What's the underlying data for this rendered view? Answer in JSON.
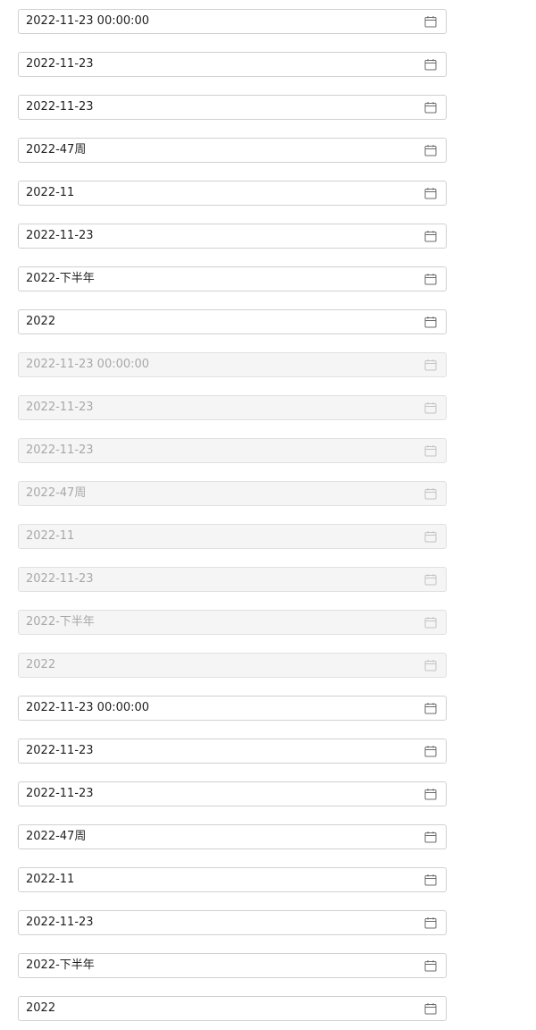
{
  "groups": [
    {
      "state": "normal",
      "pickers": [
        {
          "value": "2022-11-23 00:00:00",
          "icon": "calendar-icon"
        },
        {
          "value": "2022-11-23",
          "icon": "calendar-icon"
        },
        {
          "value": "2022-11-23",
          "icon": "calendar-icon"
        },
        {
          "value": "2022-47周",
          "icon": "calendar-icon"
        },
        {
          "value": "2022-11",
          "icon": "calendar-icon"
        },
        {
          "value": "2022-11-23",
          "icon": "calendar-icon"
        },
        {
          "value": "2022-下半年",
          "icon": "calendar-icon"
        },
        {
          "value": "2022",
          "icon": "calendar-icon"
        }
      ]
    },
    {
      "state": "disabled",
      "pickers": [
        {
          "value": "2022-11-23 00:00:00",
          "icon": "calendar-icon"
        },
        {
          "value": "2022-11-23",
          "icon": "calendar-icon"
        },
        {
          "value": "2022-11-23",
          "icon": "calendar-icon"
        },
        {
          "value": "2022-47周",
          "icon": "calendar-icon"
        },
        {
          "value": "2022-11",
          "icon": "calendar-icon"
        },
        {
          "value": "2022-11-23",
          "icon": "calendar-icon"
        },
        {
          "value": "2022-下半年",
          "icon": "calendar-icon"
        },
        {
          "value": "2022",
          "icon": "calendar-icon"
        }
      ]
    },
    {
      "state": "normal",
      "pickers": [
        {
          "value": "2022-11-23 00:00:00",
          "icon": "calendar-icon"
        },
        {
          "value": "2022-11-23",
          "icon": "calendar-icon"
        },
        {
          "value": "2022-11-23",
          "icon": "calendar-icon"
        },
        {
          "value": "2022-47周",
          "icon": "calendar-icon"
        },
        {
          "value": "2022-11",
          "icon": "calendar-icon"
        },
        {
          "value": "2022-11-23",
          "icon": "calendar-icon"
        },
        {
          "value": "2022-下半年",
          "icon": "calendar-icon"
        },
        {
          "value": "2022",
          "icon": "calendar-icon"
        }
      ]
    }
  ],
  "colors": {
    "border": "#d0d0d0",
    "text": "#1f1f1f",
    "disabled_bg": "#f5f5f5",
    "disabled_text": "#a8a8a8"
  }
}
